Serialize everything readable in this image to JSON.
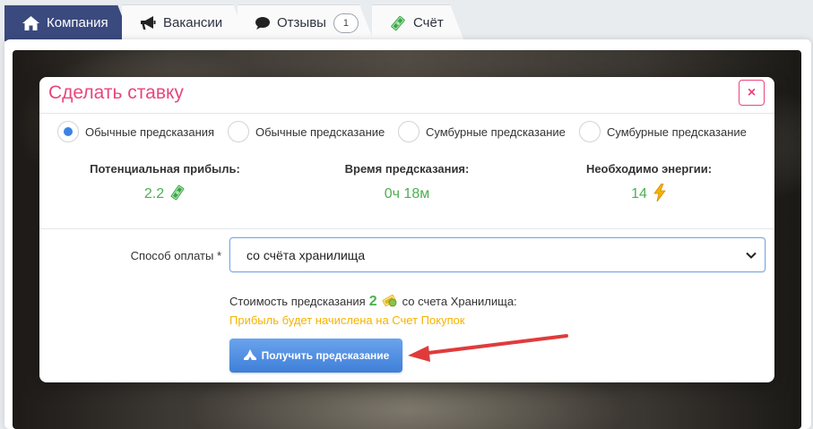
{
  "tabs": [
    {
      "label": "Компания",
      "icon": "home-icon",
      "active": true
    },
    {
      "label": "Вакансии",
      "icon": "bullhorn-icon",
      "active": false
    },
    {
      "label": "Отзывы",
      "icon": "comment-icon",
      "badge": "1",
      "active": false
    },
    {
      "label": "Счёт",
      "icon": "money-icon",
      "active": false
    }
  ],
  "modal": {
    "title": "Сделать ставку",
    "close_label": "×",
    "radios": [
      {
        "label": "Обычные предсказания",
        "checked": true
      },
      {
        "label": "Обычные предсказание",
        "checked": false
      },
      {
        "label": "Сумбурные предсказание",
        "checked": false
      },
      {
        "label": "Сумбурные предсказание",
        "checked": false
      }
    ],
    "stats": [
      {
        "label": "Потенциальная прибыль:",
        "value": "2.2",
        "icon": "money-icon"
      },
      {
        "label": "Время предсказания:",
        "value": "0ч 18м",
        "icon": ""
      },
      {
        "label": "Необходимо энергии:",
        "value": "14",
        "icon": "lightning-icon"
      }
    ],
    "payment": {
      "label": "Способ оплаты *",
      "selected": "со счёта хранилища"
    },
    "cost": {
      "prefix": "Стоимость предсказания",
      "amount": "2",
      "suffix": "со счета Хранилища:"
    },
    "note": "Прибыль будет начислена на Счет Покупок",
    "submit_label": "Получить предсказание"
  },
  "colors": {
    "accent": "#e8467c",
    "tab_active": "#3a4a7e",
    "value_green": "#4caf50",
    "note_yellow": "#f5b300",
    "button_blue": "#4a89df",
    "arrow_red": "#e03b3b"
  }
}
